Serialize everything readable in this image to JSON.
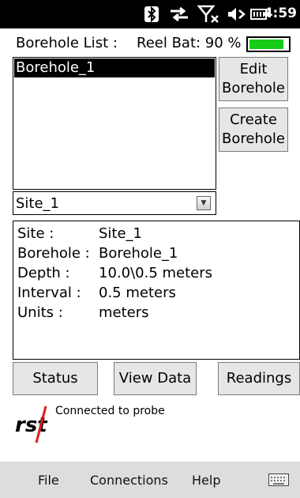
{
  "status_bar": {
    "time": "4:59",
    "icons": [
      "bluetooth-icon",
      "data-sync-icon",
      "no-signal-icon",
      "speaker-icon",
      "battery-icon"
    ]
  },
  "header": {
    "title": "Borehole List :",
    "reel_battery_label": "Reel Bat: 90 %",
    "reel_battery_level": 0.9,
    "battery_color": "#16cc16"
  },
  "borehole_list": {
    "items": [
      "Borehole_1"
    ],
    "selected_index": 0
  },
  "buttons": {
    "edit_borehole": "Edit\nBorehole",
    "create_borehole": "Create\nBorehole",
    "status": "Status",
    "view_data": "View Data",
    "readings": "Readings"
  },
  "site_select": {
    "value": "Site_1"
  },
  "details": [
    {
      "label": "Site :",
      "value": "Site_1"
    },
    {
      "label": "Borehole :",
      "value": "Borehole_1"
    },
    {
      "label": "Depth :",
      "value": "10.0\\0.5 meters"
    },
    {
      "label": "Interval :",
      "value": "0.5 meters"
    },
    {
      "label": "Units :",
      "value": "meters"
    }
  ],
  "logo": {
    "text": "rst",
    "accent": "#e41b1b"
  },
  "connection_status": "Connected to probe",
  "menu": {
    "file": "File",
    "connections": "Connections",
    "help": "Help",
    "keyboard_icon": "keyboard-icon"
  }
}
